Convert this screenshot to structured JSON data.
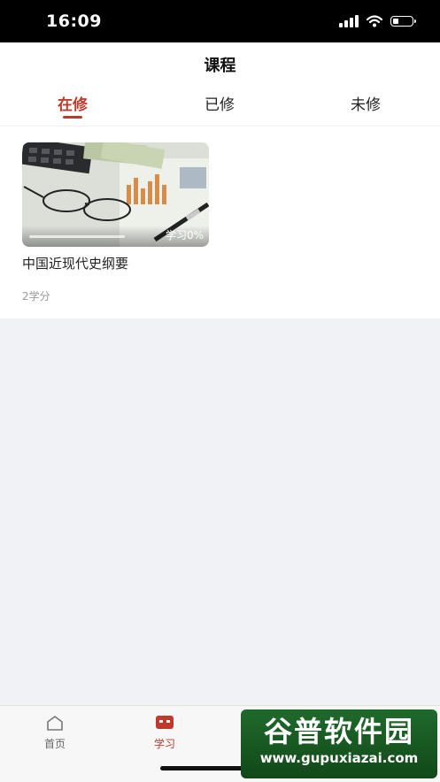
{
  "status": {
    "time": "16:09",
    "battery_level": 0.3
  },
  "header": {
    "title": "课程",
    "tabs": [
      {
        "label": "在修",
        "active": true
      },
      {
        "label": "已修",
        "active": false
      },
      {
        "label": "未修",
        "active": false
      }
    ]
  },
  "courses": [
    {
      "name": "中国近现代史纲要",
      "credit": "2学分",
      "progress_label": "学习0%",
      "progress": 0
    }
  ],
  "tabbar": {
    "items": [
      {
        "label": "首页",
        "icon": "home-icon",
        "active": false
      },
      {
        "label": "学习",
        "icon": "study-icon",
        "active": true
      }
    ]
  },
  "watermark": {
    "title": "谷普软件园",
    "url": "www.gupuxiazai.com"
  },
  "colors": {
    "accent": "#c0392b",
    "page_background": "#f1f2f6",
    "watermark_green": "#1f6a2b"
  }
}
